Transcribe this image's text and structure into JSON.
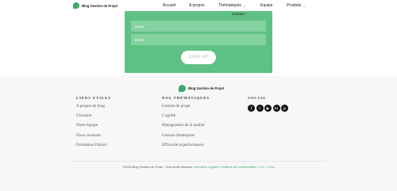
{
  "header": {
    "brand": "Blog Gestion de Projet",
    "nav": [
      {
        "label": "Accueil",
        "dropdown": false
      },
      {
        "label": "A propos",
        "dropdown": false
      },
      {
        "label": "Thématiques",
        "dropdown": true
      },
      {
        "label": "Equipe",
        "dropdown": false
      },
      {
        "label": "Produits",
        "dropdown": true
      }
    ]
  },
  "signup": {
    "contact_label": "Contact",
    "name_placeholder": "Name",
    "email_placeholder": "Email",
    "button_label": "SIGN UP"
  },
  "footer": {
    "logo_text": "Blog Gestion de Projet",
    "liens_utiles": {
      "title": "LIENS UTILES",
      "items": [
        "A propos du blog",
        "Glossaire",
        "Notre équipe",
        "Nous contacter",
        "Formation Prince2"
      ]
    },
    "thematiques": {
      "title": "NOS THÉMATIQUES",
      "items": [
        "Gestion de projet",
        "L'agilité",
        "Management de la qualité",
        "Gestion d'entreprise",
        "Efficacité et performance"
      ]
    },
    "social": {
      "title": "SOCIAL",
      "icons": [
        "facebook-icon",
        "twitter-icon",
        "youtube-icon",
        "linkedin-icon",
        "pinterest-icon"
      ]
    },
    "copyright": "©2023 Blog Gestion de Projet - Tous droits réservés",
    "legal_links": "| Mentions Légales | Politique de confidentialité | CGV - CGU"
  },
  "colors": {
    "accent": "#5fc083",
    "field": "#84d2a1",
    "footer_bg": "#f7f7f7"
  }
}
